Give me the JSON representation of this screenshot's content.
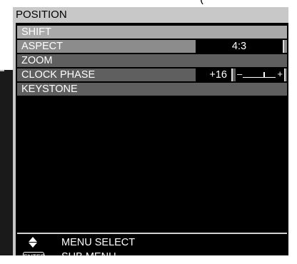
{
  "menu": {
    "title": "POSITION",
    "items": [
      {
        "label": "SHIFT"
      },
      {
        "label": "ASPECT",
        "value": "4:3"
      },
      {
        "label": "ZOOM"
      },
      {
        "label": "CLOCK PHASE",
        "value": "+16",
        "slider_level": 0.62
      },
      {
        "label": "KEYSTONE"
      }
    ],
    "footer": {
      "menu_select_label": "MENU SELECT",
      "enter_label": "ENTER",
      "sub_menu_label": "SUB MENU"
    },
    "slider": {
      "minus": "–",
      "plus": "+"
    },
    "top_fragment": "("
  }
}
